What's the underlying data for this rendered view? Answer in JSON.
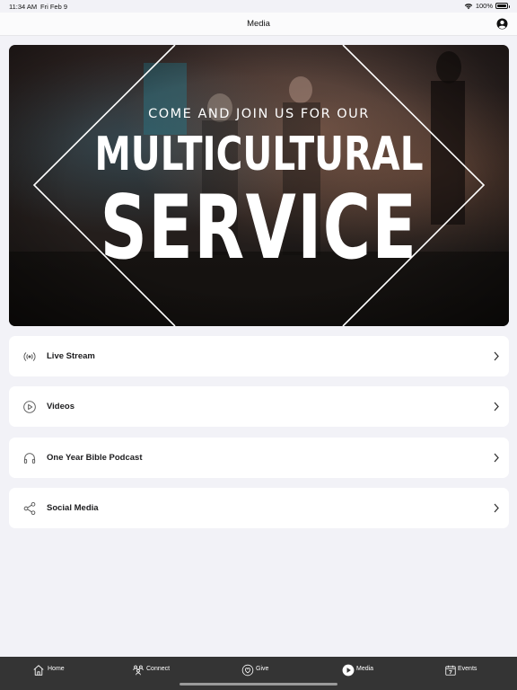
{
  "status_bar": {
    "time": "11:34 AM",
    "date": "Fri Feb 9",
    "battery": "100%",
    "battery_level": 1.0,
    "icons": [
      "wifi-icon",
      "battery-icon"
    ]
  },
  "nav": {
    "title": "Media",
    "profile_icon": "person-circle-icon"
  },
  "hero": {
    "subtitle": "COME AND JOIN US FOR OUR",
    "line1": "MULTICULTURAL",
    "line2": "SERVICE"
  },
  "menu": {
    "items": [
      {
        "label": "Live Stream",
        "icon": "broadcast-icon"
      },
      {
        "label": "Videos",
        "icon": "play-circle-icon"
      },
      {
        "label": "One Year Bible Podcast",
        "icon": "headphones-icon"
      },
      {
        "label": "Social Media",
        "icon": "share-icon"
      }
    ],
    "chevron_icon": "chevron-right-icon"
  },
  "tabs": {
    "active": "Media",
    "items": [
      {
        "label": "Home",
        "icon": "home-icon"
      },
      {
        "label": "Connect",
        "icon": "people-icon"
      },
      {
        "label": "Give",
        "icon": "heart-circle-icon"
      },
      {
        "label": "Media",
        "icon": "play-circle-filled-icon"
      },
      {
        "label": "Events",
        "icon": "calendar-icon"
      }
    ]
  },
  "colors": {
    "background": "#f2f2f7",
    "card": "#ffffff",
    "tab_bar": "#343434",
    "text": "#1c1c1e"
  }
}
